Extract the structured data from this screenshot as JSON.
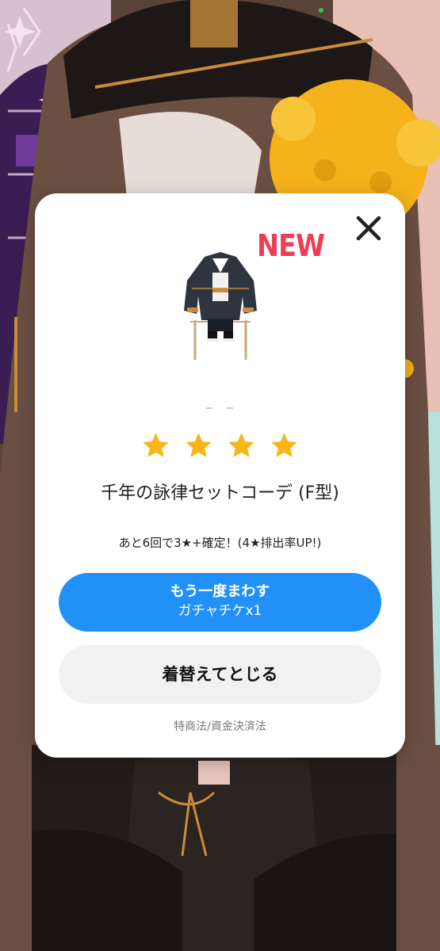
{
  "modal": {
    "new_badge": "NEW",
    "item_name": "千年の詠律セットコーデ (F型)",
    "rarity_stars": 4,
    "star_color": "#f7b519",
    "note": "あと6回で3★+確定！(4★排出率UP!)",
    "primary_button": {
      "line1": "もう一度まわす",
      "line2": "ガチャチケx1",
      "color": "#2291f7"
    },
    "secondary_button": {
      "label": "着替えてとじる"
    },
    "legal_link": "特商法/資金決済法",
    "close_icon": "close-icon",
    "new_badge_color": "#f03c55"
  }
}
